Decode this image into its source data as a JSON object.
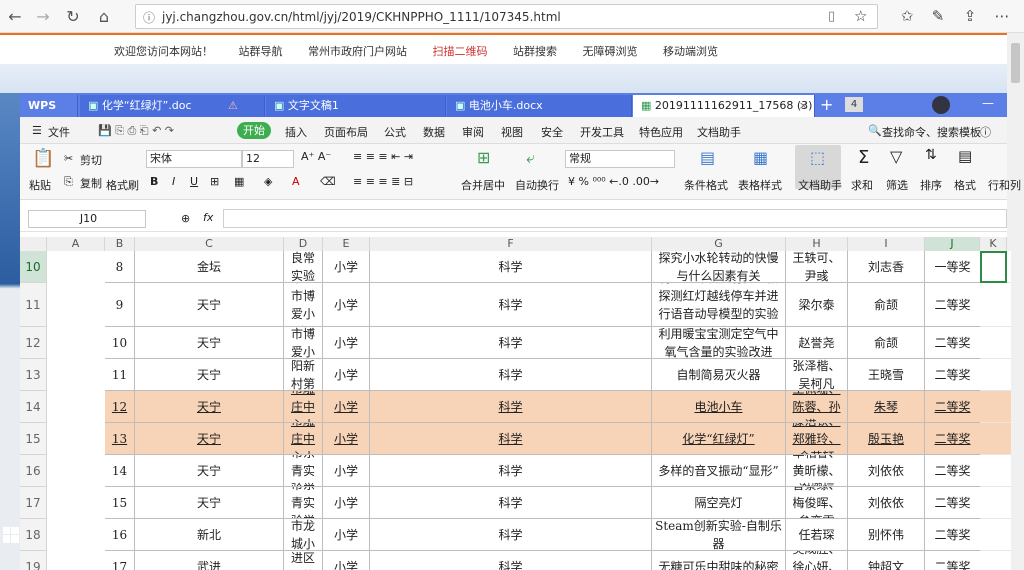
{
  "browser": {
    "url": "jyj.changzhou.gov.cn/html/jyj/2019/CKHNPPHO_1111/107345.html"
  },
  "site": {
    "links": [
      "欢迎您访问本网站！",
      "站群导航",
      "常州市政府门户网站",
      "扫描二维码",
      "站群搜索",
      "无障碍浏览",
      "移动端浏览"
    ]
  },
  "wps": {
    "home_tab": "WPS",
    "tabs": [
      "化学“红绿灯”.doc",
      "文字文稿1",
      "电池小车.docx",
      "20191111162911_17568 (3)"
    ],
    "tab_count": "4",
    "menu": [
      "文件",
      "开始",
      "插入",
      "页面布局",
      "公式",
      "数据",
      "审阅",
      "视图",
      "安全",
      "开发工具",
      "特色应用",
      "文档助手"
    ],
    "search": "查找命令、搜索模板",
    "ribbon": {
      "paste": "粘贴",
      "cut": "剪切",
      "copy": "复制",
      "format_painter": "格式刷",
      "font": "宋体",
      "size": "12",
      "merge": "合并居中",
      "wrap": "自动换行",
      "numfmt": "常规",
      "cond": "条件格式",
      "table_style": "表格样式",
      "doc_helper": "文档助手",
      "sum": "求和",
      "filter": "筛选",
      "sort": "排序",
      "format": "格式",
      "rowcol": "行和列"
    },
    "name_box": "J10",
    "fx": "fx"
  },
  "sheet": {
    "columns": [
      "A",
      "B",
      "C",
      "D",
      "E",
      "F",
      "G",
      "H",
      "I",
      "J",
      "K"
    ],
    "rows": [
      {
        "rn": "10",
        "cells": [
          "8",
          "金坛",
          "金坛良常实验小学",
          "小学",
          "科学",
          "探究小水轮转动的快慢与什么因素有关",
          "王轶可、尹彧",
          "刘志香",
          "一等奖"
        ],
        "hl": false
      },
      {
        "rn": "11",
        "cells": [
          "9",
          "天宁",
          "常州市博爱小学",
          "小学",
          "科学",
          "利用红外漫反射传感器探测红灯越线停车并进行语音动导模型的实验研究",
          "梁尔泰",
          "俞颉",
          "二等奖"
        ],
        "hl": false
      },
      {
        "rn": "12",
        "cells": [
          "10",
          "天宁",
          "常州市博爱小学",
          "小学",
          "科学",
          "利用暖宝宝测定空气中氧气含量的实验改进",
          "赵誉尧",
          "俞颉",
          "二等奖"
        ],
        "hl": false
      },
      {
        "rn": "13",
        "cells": [
          "11",
          "天宁",
          "常州市朝阳新村第二小学",
          "小学",
          "科学",
          "自制简易灭火器",
          "张泽楷、吴柯凡",
          "王晓雪",
          "二等奖"
        ],
        "hl": false
      },
      {
        "rn": "14",
        "cells": [
          "12",
          "天宁",
          "常州市雕庄中心小学",
          "小学",
          "科学",
          "电池小车",
          "王佩珊、陈蓉、孙诺一",
          "朱琴",
          "二等奖"
        ],
        "hl": true
      },
      {
        "rn": "15",
        "cells": [
          "13",
          "天宁",
          "常州市雕庄中心小学",
          "小学",
          "科学",
          "化学“红绿灯”",
          "滕浩钦、郑雅玲、金艺轩",
          "殷玉艳",
          "二等奖"
        ],
        "hl": true
      },
      {
        "rn": "16",
        "cells": [
          "14",
          "天宁",
          "常州市东青实验学校",
          "小学",
          "科学",
          "多样的音叉振动“显形”",
          "单相睿、黄昕檬、谢熠恒",
          "刘依依",
          "二等奖"
        ],
        "hl": false
      },
      {
        "rn": "17",
        "cells": [
          "15",
          "天宁",
          "常州市东青实验学校",
          "小学",
          "科学",
          "隔空亮灯",
          "曹景缘、梅俊晖、牟弈霏",
          "刘依依",
          "二等奖"
        ],
        "hl": false
      },
      {
        "rn": "18",
        "cells": [
          "16",
          "新北",
          "常州市龙城小学",
          "小学",
          "科学",
          "Steam创新实验-自制乐器",
          "任若琛",
          "别怀伟",
          "二等奖"
        ],
        "hl": false
      },
      {
        "rn": "19",
        "cells": [
          "17",
          "武进",
          "常州市武进区马杭中心小学",
          "小学",
          "科学",
          "无糖可乐中甜味的秘密",
          "吴成胜、徐心妍、徐佳",
          "钟超文",
          "二等奖"
        ],
        "hl": false
      }
    ]
  }
}
